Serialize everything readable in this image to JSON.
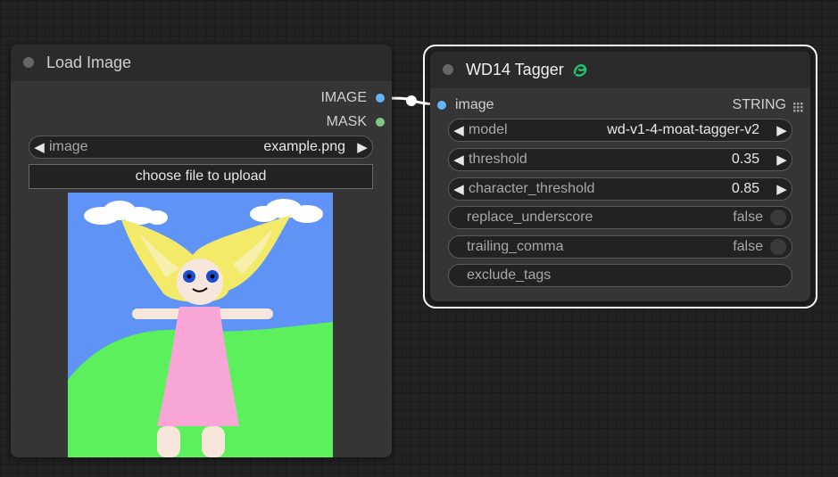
{
  "load_image": {
    "title": "Load Image",
    "outputs": [
      {
        "label": "IMAGE",
        "color": "#64b5f6"
      },
      {
        "label": "MASK",
        "color": "#81c784"
      }
    ],
    "image_widget": {
      "label": "image",
      "value": "example.png"
    },
    "upload_button": "choose file to upload",
    "preview_icon": "child-drawing-image"
  },
  "tagger": {
    "title": "WD14 Tagger",
    "title_icon": "custom-node-badge-icon",
    "input": {
      "label": "image",
      "color": "#64b5f6"
    },
    "output": {
      "label": "STRING",
      "icon": "grid-dots-icon"
    },
    "widgets": {
      "model": {
        "label": "model",
        "value": "wd-v1-4-moat-tagger-v2"
      },
      "threshold": {
        "label": "threshold",
        "value": "0.35"
      },
      "character_threshold": {
        "label": "character_threshold",
        "value": "0.85"
      },
      "replace_underscore": {
        "label": "replace_underscore",
        "value": "false"
      },
      "trailing_comma": {
        "label": "trailing_comma",
        "value": "false"
      },
      "exclude_tags": {
        "label": "exclude_tags",
        "value": ""
      }
    }
  },
  "colors": {
    "link": "#ffffff",
    "selected_outline": "#ffffff",
    "badge": "#1ec870"
  }
}
